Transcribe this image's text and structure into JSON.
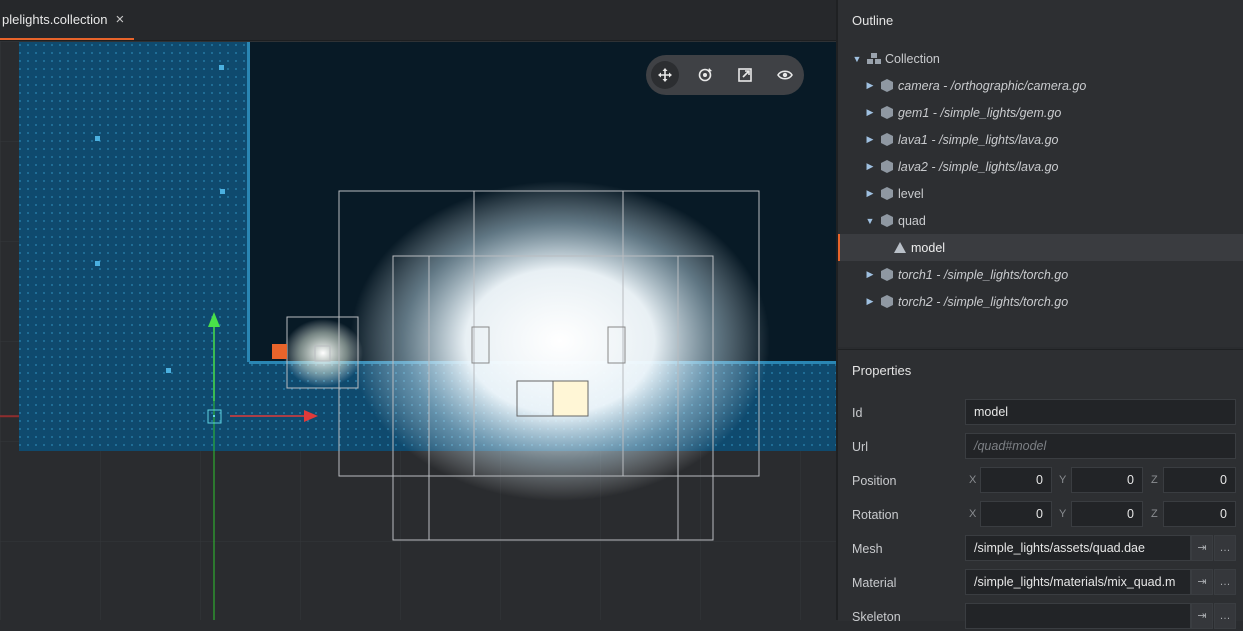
{
  "editor_tab": {
    "title": "plelights.collection",
    "close_icon": "×"
  },
  "toolbar": {
    "tools": [
      {
        "name": "move-tool",
        "active": true
      },
      {
        "name": "rotate-tool",
        "active": false
      },
      {
        "name": "scale-tool",
        "active": false
      },
      {
        "name": "view-tool",
        "active": false
      }
    ]
  },
  "outline": {
    "title": "Outline",
    "root": {
      "label": "Collection"
    },
    "items": [
      {
        "label": "camera - /orthographic/camera.go",
        "italic": true
      },
      {
        "label": "gem1 - /simple_lights/gem.go",
        "italic": true
      },
      {
        "label": "lava1 - /simple_lights/lava.go",
        "italic": true
      },
      {
        "label": "lava2 - /simple_lights/lava.go",
        "italic": true
      },
      {
        "label": "level",
        "italic": false
      },
      {
        "label": "quad",
        "italic": false,
        "expanded": true
      },
      {
        "label": "model",
        "child": true,
        "selected": true
      },
      {
        "label": "torch1 - /simple_lights/torch.go",
        "italic": true
      },
      {
        "label": "torch2 - /simple_lights/torch.go",
        "italic": true
      }
    ]
  },
  "properties": {
    "title": "Properties",
    "id": {
      "label": "Id",
      "value": "model"
    },
    "url": {
      "label": "Url",
      "placeholder": "/quad#model"
    },
    "position": {
      "label": "Position",
      "x": "0",
      "y": "0",
      "z": "0"
    },
    "rotation": {
      "label": "Rotation",
      "x": "0",
      "y": "0",
      "z": "0"
    },
    "axis_labels": {
      "x": "X",
      "y": "Y",
      "z": "Z"
    },
    "mesh": {
      "label": "Mesh",
      "value": "/simple_lights/assets/quad.dae"
    },
    "material": {
      "label": "Material",
      "value": "/simple_lights/materials/mix_quad.m"
    },
    "skeleton": {
      "label": "Skeleton",
      "value": ""
    },
    "goto_icon": "⇥",
    "more_icon": "…"
  },
  "colors": {
    "accent": "#e8642b",
    "panel": "#2d2f32",
    "viewport": "#2a2c2f",
    "level_blue": "#0f4a6e",
    "sky": "#081a26"
  }
}
